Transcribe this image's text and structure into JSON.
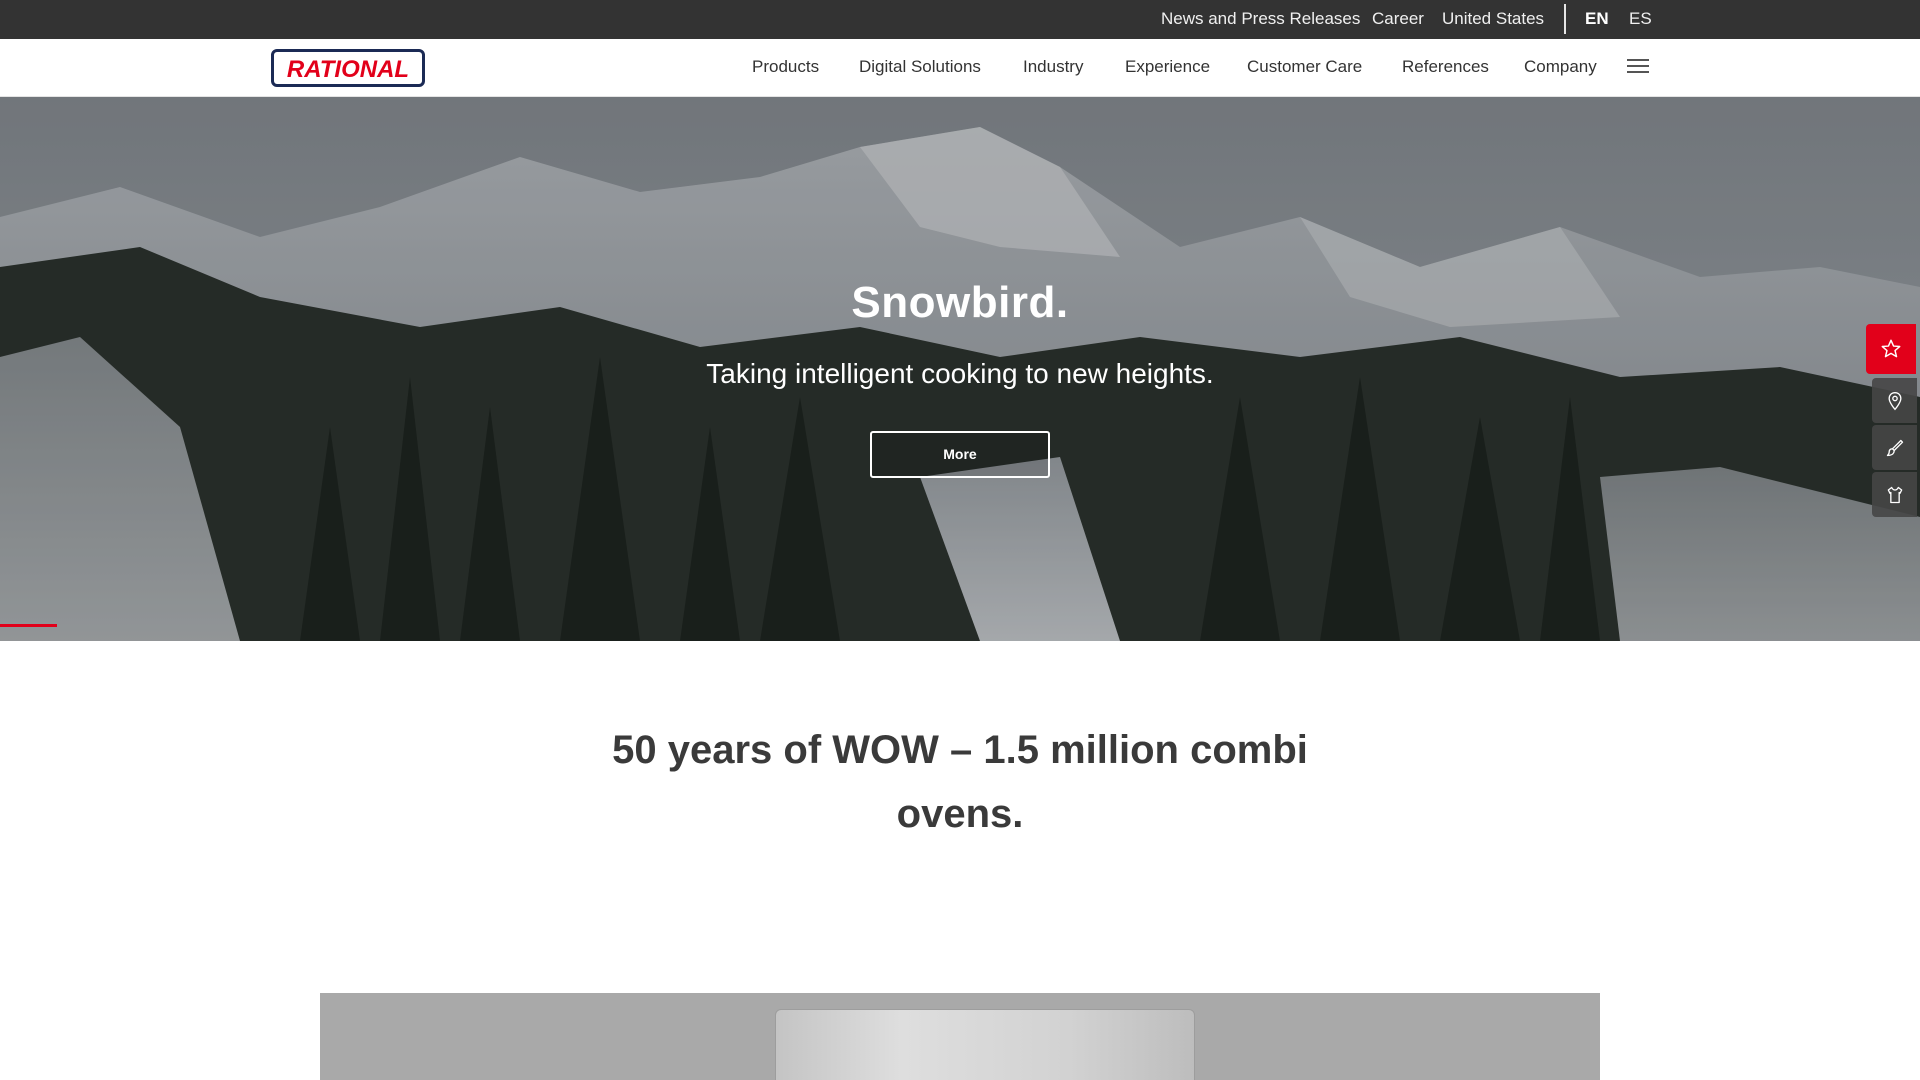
{
  "utility_nav": {
    "links": [
      "News and Press Releases",
      "Career",
      "United States"
    ],
    "languages": [
      "EN",
      "ES"
    ],
    "active_language": "EN"
  },
  "brand": {
    "logo_text": "RATIONAL",
    "logo_color": "#e2001a",
    "logo_frame_color": "#1b2a55"
  },
  "main_nav": {
    "items": [
      "Products",
      "Digital Solutions",
      "Industry",
      "Experience",
      "Customer Care",
      "References",
      "Company"
    ],
    "menu_icon": "hamburger-icon"
  },
  "hero": {
    "title": "Snowbird.",
    "subtitle": "Taking intelligent cooking to new heights.",
    "button_label": "More"
  },
  "side_actions": [
    {
      "icon": "star-icon",
      "highlighted": true
    },
    {
      "icon": "location-pin-icon",
      "highlighted": false
    },
    {
      "icon": "brush-icon",
      "highlighted": false
    },
    {
      "icon": "shirt-icon",
      "highlighted": false
    }
  ],
  "headline": {
    "text": "50 years of WOW – 1.5 million combi ovens."
  },
  "colors": {
    "accent": "#e2001a",
    "utility_bar": "#333333",
    "text": "#3a3a3a"
  }
}
